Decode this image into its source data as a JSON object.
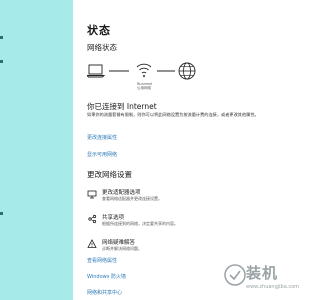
{
  "status_page": {
    "title": "状态",
    "network_status_heading": "网络状态",
    "network_name": "Ruanmei",
    "access_type": "公用网络",
    "connected_heading": "你已连接到 Internet",
    "connected_desc": "如果你的流量套餐有限制，则你可以将此网络设置为按流量计费的连接，或者更改其他属性。",
    "link_change_properties": "更改连接属性",
    "link_show_networks": "显示可用网络",
    "change_settings_heading": "更改网络设置",
    "options": [
      {
        "title": "更改适配器选项",
        "desc": "查看网络适配器并更改连接设置。"
      },
      {
        "title": "共享选项",
        "desc": "根据所连接到的网络，决定要共享的内容。"
      },
      {
        "title": "网络疑难解答",
        "desc": "诊断并解决网络问题。"
      }
    ],
    "link_view_properties": "查看网络属性",
    "link_firewall": "Windows 防火墙",
    "link_sharing_center": "网络和共享中心"
  },
  "watermark": {
    "text": "装机",
    "sub": "www.zhuangjiba.com"
  },
  "colors": {
    "sidebar_bg": "#a6ebe9",
    "link": "#2d7ab8"
  },
  "icons": [
    "laptop-icon",
    "wifi-icon",
    "globe-icon",
    "adapter-icon",
    "sharing-icon",
    "troubleshoot-icon"
  ]
}
